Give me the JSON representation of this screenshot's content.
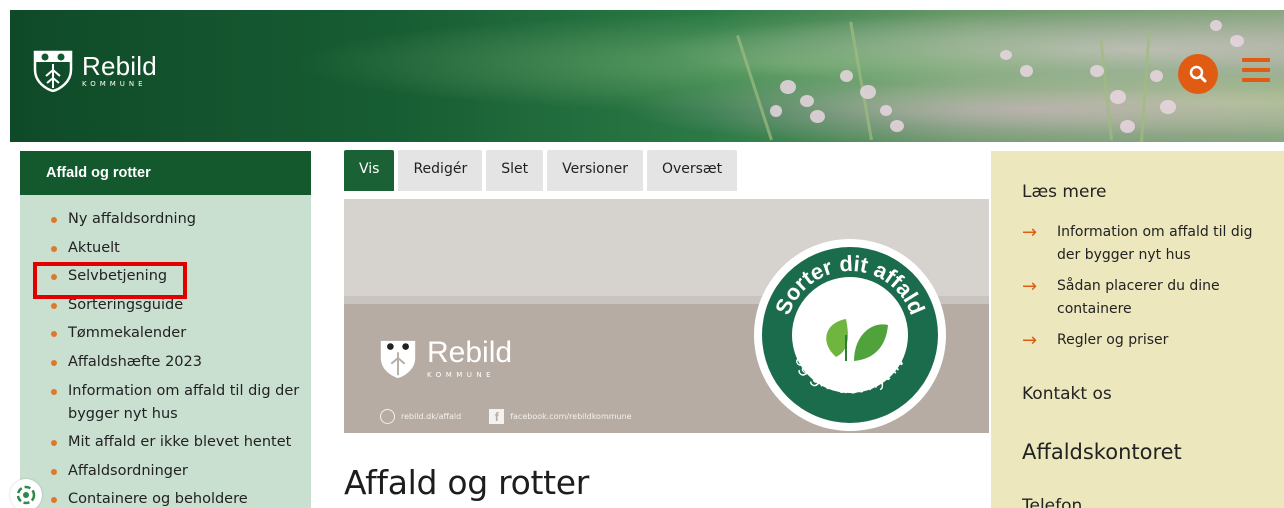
{
  "header": {
    "logo_name": "Rebild",
    "logo_sub": "KOMMUNE",
    "search_icon": "search-icon",
    "menu_icon": "hamburger-menu-icon",
    "accent_color": "#e05c12"
  },
  "sidebar": {
    "title": "Affald og rotter",
    "items": [
      {
        "label": "Ny affaldsordning"
      },
      {
        "label": "Aktuelt"
      },
      {
        "label": "Selvbetjening"
      },
      {
        "label": "Sorteringsguide"
      },
      {
        "label": "Tømmekalender"
      },
      {
        "label": "Affaldshæfte 2023"
      },
      {
        "label": "Information om affald til dig der bygger nyt hus"
      },
      {
        "label": "Mit affald er ikke blevet hentet"
      },
      {
        "label": "Affaldsordninger"
      },
      {
        "label": "Containere og beholdere"
      }
    ],
    "highlight_color": "#e10000"
  },
  "tabs": [
    {
      "label": "Vis"
    },
    {
      "label": "Redigér"
    },
    {
      "label": "Slet"
    },
    {
      "label": "Versioner"
    },
    {
      "label": "Oversæt"
    }
  ],
  "banner": {
    "logo_name": "Rebild",
    "logo_sub": "KOMMUNE",
    "link_web": "rebild.dk/affald",
    "link_facebook": "facebook.com/rebildkommune",
    "badge_top": "Sorter dit affald",
    "badge_bottom": "og giv det nyt liv"
  },
  "main": {
    "title": "Affald og rotter"
  },
  "aside": {
    "read_more_title": "Læs mere",
    "links": [
      {
        "label": "Information om affald til dig der bygger nyt hus"
      },
      {
        "label": "Sådan placerer du dine containere"
      },
      {
        "label": "Regler og priser"
      }
    ],
    "contact_title": "Kontakt os",
    "office_title": "Affaldskontoret",
    "cut_off_title": "Telefon"
  },
  "colors": {
    "brand_green": "#14582e",
    "sidebar_bg": "#c9dfd0",
    "aside_bg": "#ece7bd",
    "bullet": "#e0782a"
  }
}
